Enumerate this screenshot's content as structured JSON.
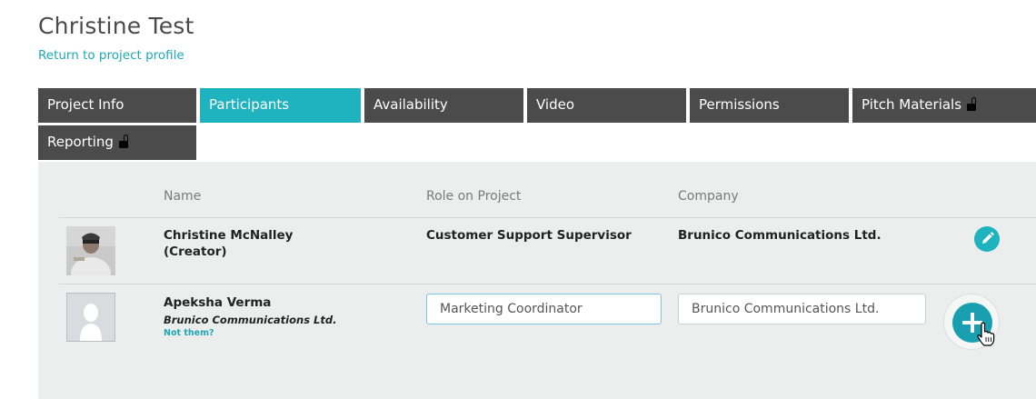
{
  "page": {
    "title": "Christine Test",
    "return_link": "Return to project profile"
  },
  "tabs": [
    {
      "label": "Project Info",
      "active": false,
      "locked": false
    },
    {
      "label": "Participants",
      "active": true,
      "locked": false
    },
    {
      "label": "Availability",
      "active": false,
      "locked": false
    },
    {
      "label": "Video",
      "active": false,
      "locked": false
    },
    {
      "label": "Permissions",
      "active": false,
      "locked": false
    },
    {
      "label": "Pitch Materials",
      "active": false,
      "locked": true
    },
    {
      "label": "Reporting",
      "active": false,
      "locked": true
    }
  ],
  "table": {
    "headers": {
      "name": "Name",
      "role": "Role on Project",
      "company": "Company"
    },
    "rows": [
      {
        "name": "Christine McNalley",
        "name_note": "(Creator)",
        "role": "Customer Support Supervisor",
        "company": "Brunico Communications Ltd.",
        "action_icon": "pencil-icon"
      }
    ],
    "new_participant": {
      "name": "Apeksha Verma",
      "company": "Brunico Communications Ltd.",
      "not_them": "Not them?",
      "role_input_value": "Marketing Coordinator",
      "company_input_value": "Brunico Communications Ltd.",
      "action_icon": "plus-icon"
    }
  },
  "colors": {
    "accent": "#1fb3bf",
    "tab_inactive": "#4b4b4b",
    "panel_bg": "#eceeee",
    "link": "#1fa7b4"
  }
}
